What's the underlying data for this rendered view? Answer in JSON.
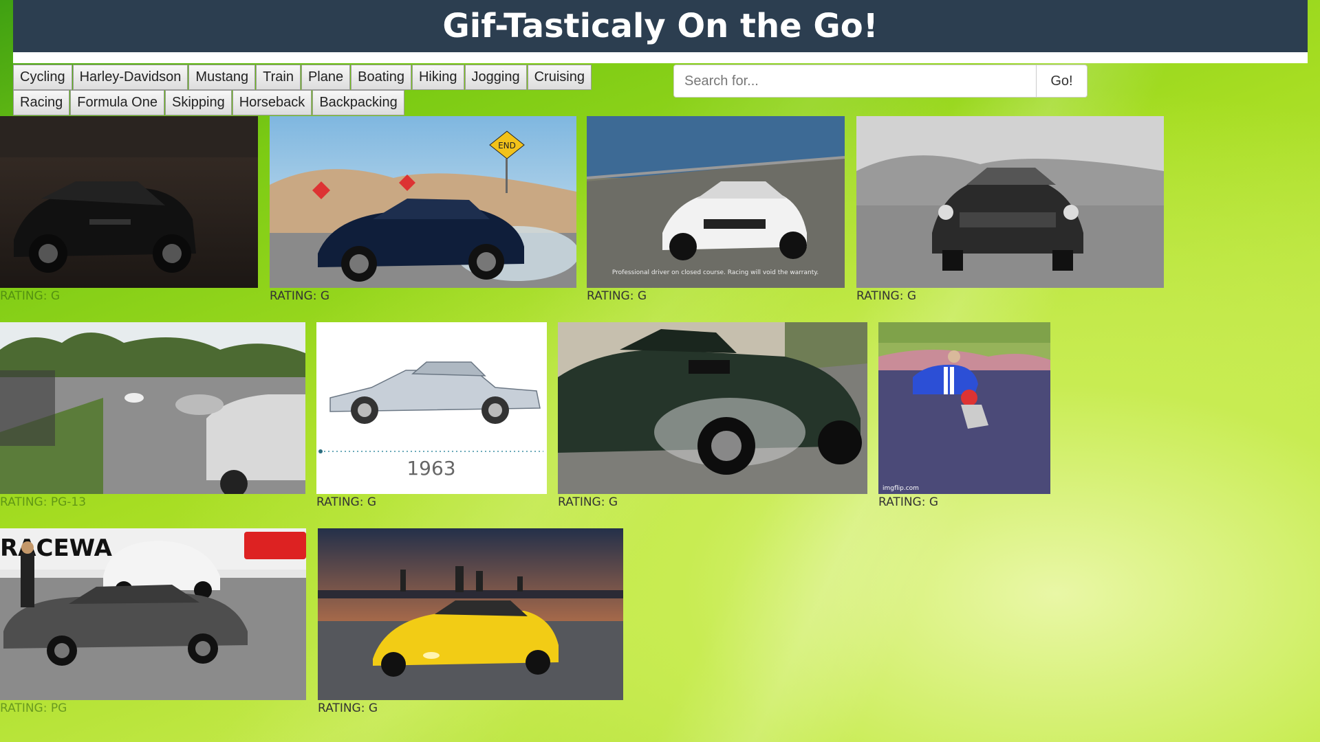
{
  "header": {
    "title": "Gif-Tasticaly On the Go!"
  },
  "topics": [
    "Cycling",
    "Harley-Davidson",
    "Mustang",
    "Train",
    "Plane",
    "Boating",
    "Hiking",
    "Jogging",
    "Cruising",
    "Racing",
    "Formula One",
    "Skipping",
    "Horseback",
    "Backpacking"
  ],
  "search": {
    "placeholder": "Search for...",
    "button_label": "Go!"
  },
  "gifs": [
    {
      "rating": "RATING: G",
      "caption": ""
    },
    {
      "rating": "RATING: G",
      "caption": "END"
    },
    {
      "rating": "RATING: G",
      "caption": "Professional driver on closed course. Racing will void the warranty."
    },
    {
      "rating": "RATING: G",
      "caption": ""
    },
    {
      "rating": "RATING: PG-13",
      "caption": ""
    },
    {
      "rating": "RATING: G",
      "caption": "1963"
    },
    {
      "rating": "RATING: G",
      "caption": ""
    },
    {
      "rating": "RATING: G",
      "caption": "imgflip.com"
    },
    {
      "rating": "RATING: PG",
      "caption": "RACEWA"
    },
    {
      "rating": "RATING: G",
      "caption": ""
    }
  ],
  "colors": {
    "header_bg": "#2c3e50",
    "header_text": "#ffffff"
  }
}
